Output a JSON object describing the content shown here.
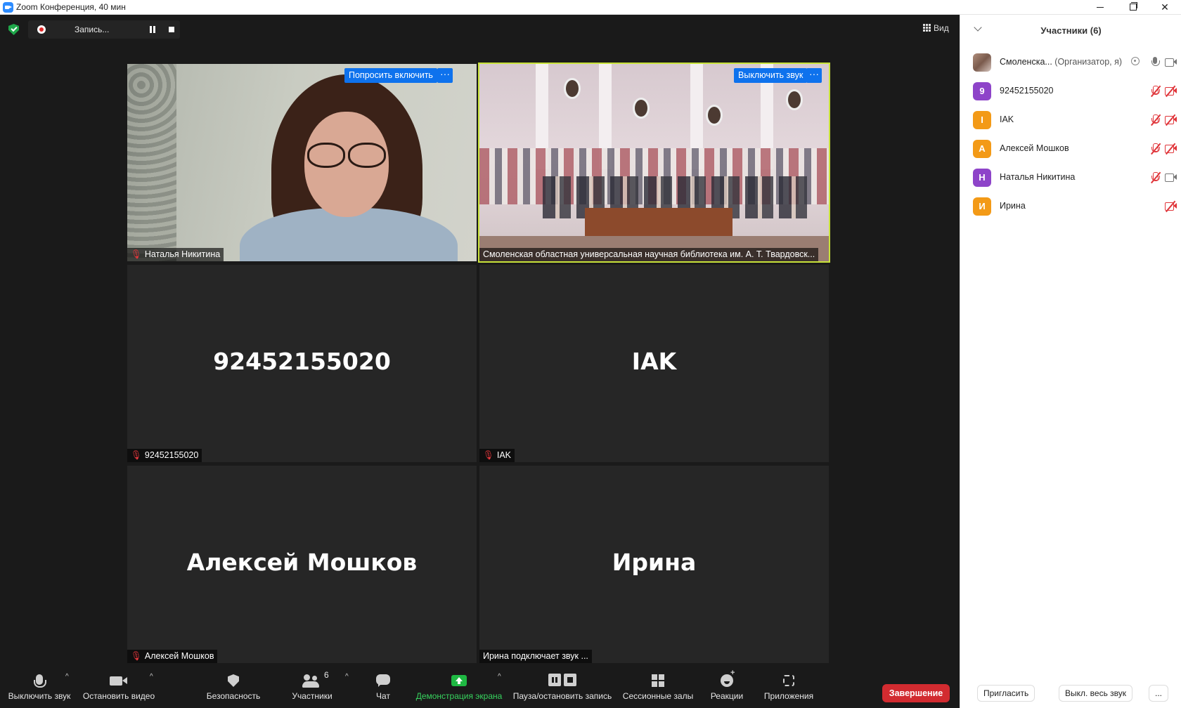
{
  "window": {
    "title": "Zoom Конференция, 40 мин"
  },
  "topbar": {
    "recording_label": "Запись...",
    "view_label": "Вид"
  },
  "tiles": [
    {
      "name": "Наталья Никитина",
      "button": "Попросить включить",
      "more": "···"
    },
    {
      "name": "Смоленская областная универсальная научная библиотека им. А. Т. Твардовск...",
      "button": "Выключить звук",
      "more": "···"
    },
    {
      "big": "92452155020",
      "name": "92452155020"
    },
    {
      "big": "IAK",
      "name": "IAK"
    },
    {
      "big": "Алексей Мошков",
      "name": "Алексей Мошков"
    },
    {
      "big": "Ирина",
      "name": "Ирина подключает звук ..."
    }
  ],
  "toolbar": {
    "mute": "Выключить звук",
    "video": "Остановить видео",
    "security": "Безопасность",
    "participants": "Участники",
    "participants_count": "6",
    "chat": "Чат",
    "share": "Демонстрация экрана",
    "record": "Пауза/остановить запись",
    "rooms": "Сессионные залы",
    "reactions": "Реакции",
    "apps": "Приложения",
    "end": "Завершение",
    "caret": "^"
  },
  "panel": {
    "title": "Участники (6)",
    "participants": [
      {
        "avatar": "",
        "name": "Смоленска...",
        "role": "(Организатор, я)",
        "avatar_color": "#9a7464"
      },
      {
        "avatar": "9",
        "name": "92452155020",
        "avatar_color": "#8e44c9"
      },
      {
        "avatar": "I",
        "name": "IAK",
        "avatar_color": "#f39a17"
      },
      {
        "avatar": "А",
        "name": "Алексей Мошков",
        "avatar_color": "#f39a17"
      },
      {
        "avatar": "Н",
        "name": "Наталья Никитина",
        "avatar_color": "#8e44c9"
      },
      {
        "avatar": "И",
        "name": "Ирина",
        "avatar_color": "#f39a17"
      }
    ],
    "invite": "Пригласить",
    "mute_all": "Выкл. весь звук",
    "more": "..."
  }
}
